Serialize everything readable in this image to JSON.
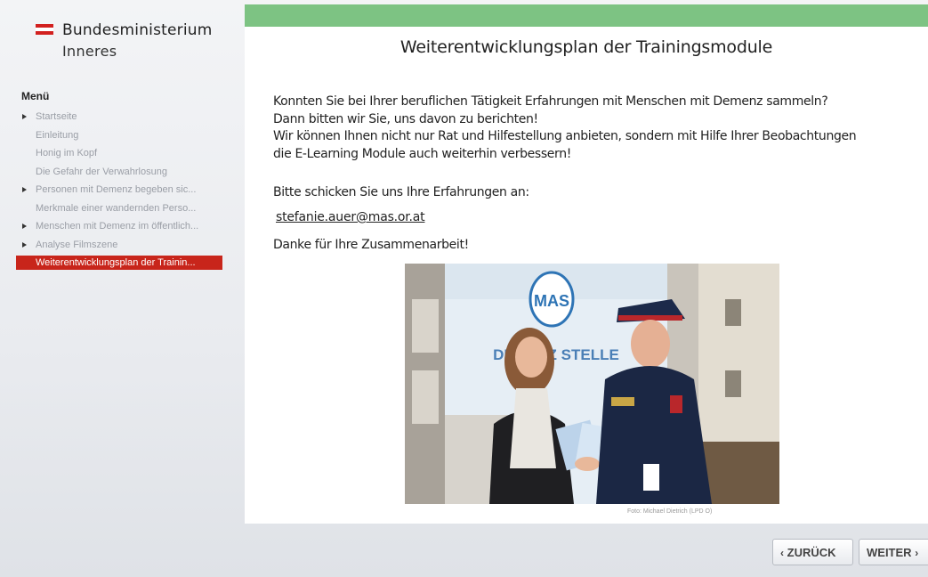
{
  "brand": {
    "line1": "Bundesministerium",
    "line2": "Inneres",
    "flag_colors": [
      "#d2201f",
      "#ffffff",
      "#d2201f"
    ]
  },
  "sidebar": {
    "menu_title": "Menü",
    "items": [
      {
        "label": "Startseite",
        "expandable": true
      },
      {
        "label": "Einleitung",
        "expandable": false
      },
      {
        "label": "Honig im Kopf",
        "expandable": false
      },
      {
        "label": "Die Gefahr der Verwahrlosung",
        "expandable": false
      },
      {
        "label": "Personen mit Demenz begeben sic...",
        "expandable": true
      },
      {
        "label": "Merkmale einer wandernden Perso...",
        "expandable": false
      },
      {
        "label": "Menschen mit Demenz im öffentlich...",
        "expandable": true
      },
      {
        "label": "Analyse Filmszene",
        "expandable": true
      },
      {
        "label": "Weiterentwicklungsplan der Trainin...",
        "expandable": false,
        "active": true
      }
    ]
  },
  "main": {
    "accent": "#7dc383",
    "title": "Weiterentwicklungsplan der Trainingsmodule",
    "paragraph": [
      "Konnten Sie bei Ihrer beruflichen Tätigkeit Erfahrungen mit Menschen mit Demenz sammeln?",
      "Dann bitten wir Sie, uns davon zu berichten!",
      "Wir können Ihnen nicht nur Rat und Hilfestellung anbieten, sondern mit Hilfe Ihrer Beobachtungen",
      "die E-Learning Module auch weiterhin verbessern!"
    ],
    "send_text": "Bitte schicken Sie uns Ihre Erfahrungen an:",
    "email": "stefanie.auer@mas.or.at",
    "thanks": "Danke für Ihre Zusammenarbeit!",
    "photo": {
      "logo_text": "MAS",
      "banner_text": "DEMENZ   STELLE",
      "credit": "Foto: Michael Dietrich (LPD O)"
    }
  },
  "nav": {
    "back_label": "ZURÜCK",
    "next_label": "WEITER"
  }
}
